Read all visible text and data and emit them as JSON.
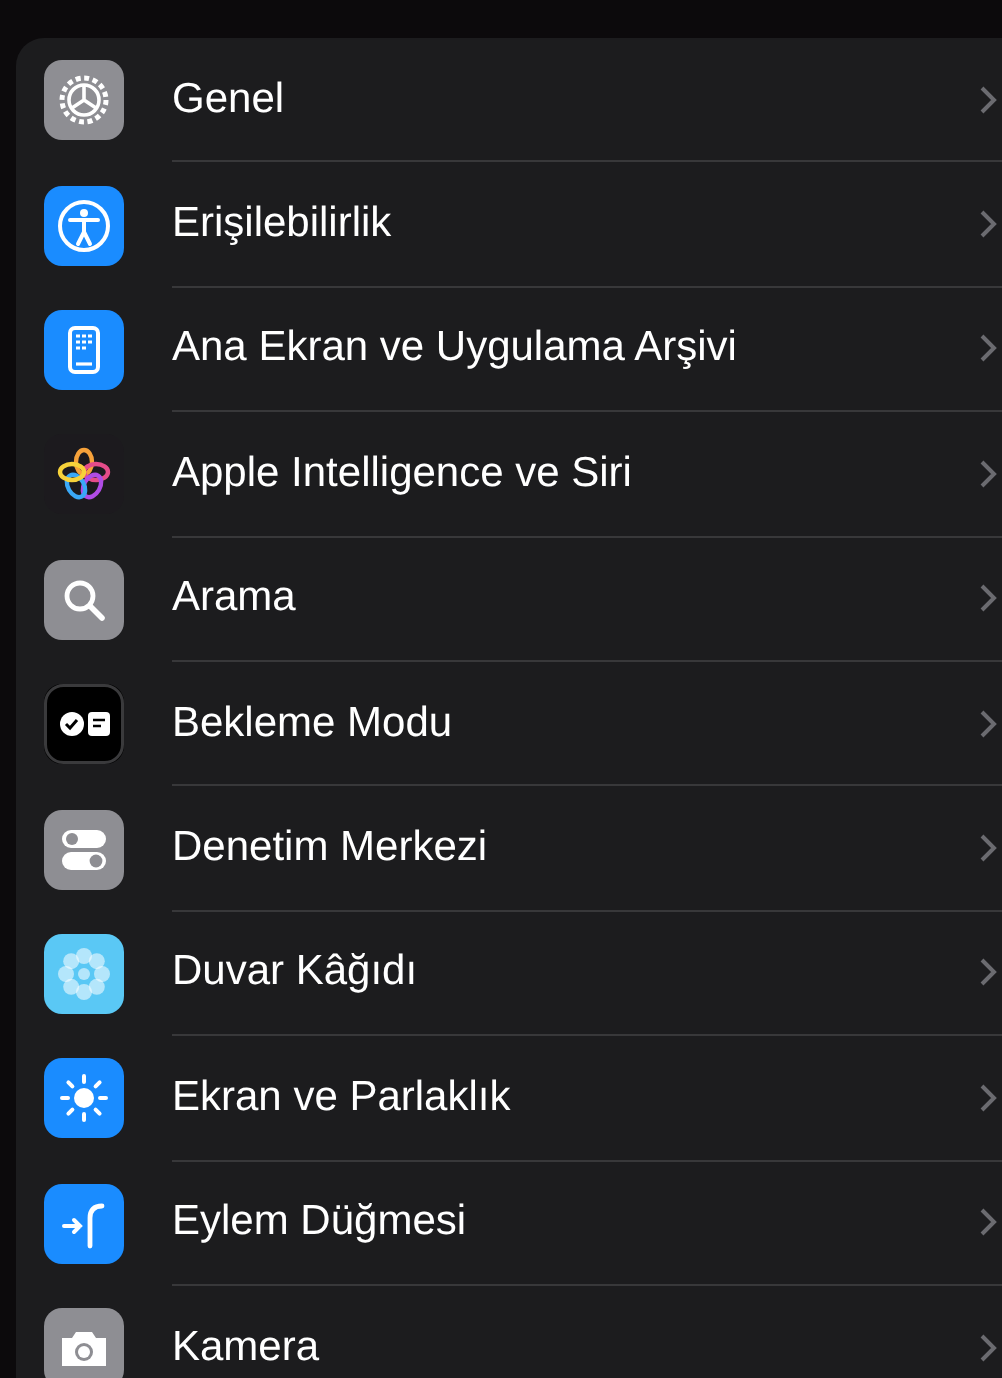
{
  "settings": [
    {
      "label": "Genel",
      "kind": "gear",
      "color": "#8e8e93"
    },
    {
      "label": "Erişilebilirlik",
      "kind": "accessibility",
      "color": "#1a8cff"
    },
    {
      "label": "Ana Ekran ve Uygulama Arşivi",
      "kind": "homescreen",
      "color": "#1a8cff"
    },
    {
      "label": "Apple Intelligence ve Siri",
      "kind": "intelligence",
      "color": "#1c1a1e"
    },
    {
      "label": "Arama",
      "kind": "search",
      "color": "#8e8e93"
    },
    {
      "label": "Bekleme Modu",
      "kind": "standby",
      "color": "#000000"
    },
    {
      "label": "Denetim Merkezi",
      "kind": "toggles",
      "color": "#8e8e93"
    },
    {
      "label": "Duvar Kâğıdı",
      "kind": "flower",
      "color": "#5ac8f5"
    },
    {
      "label": "Ekran ve Parlaklık",
      "kind": "sun",
      "color": "#1a8cff"
    },
    {
      "label": "Eylem Düğmesi",
      "kind": "action",
      "color": "#1a8cff"
    },
    {
      "label": "Kamera",
      "kind": "camera",
      "color": "#8e8e93"
    }
  ]
}
